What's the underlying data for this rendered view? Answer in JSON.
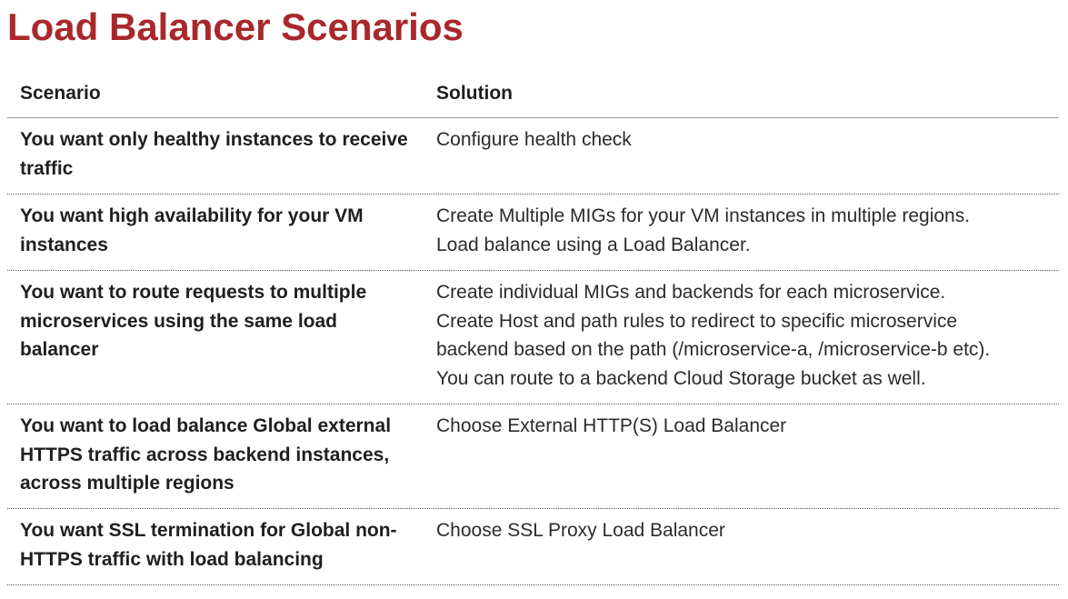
{
  "title": "Load Balancer Scenarios",
  "table": {
    "headers": {
      "scenario": "Scenario",
      "solution": "Solution"
    },
    "rows": [
      {
        "scenario": "You want only healthy instances to receive traffic",
        "solution": [
          "Configure health check"
        ]
      },
      {
        "scenario": "You want high availability for your VM instances",
        "solution": [
          "Create Multiple MIGs for your VM instances in multiple regions.",
          "Load balance using a Load Balancer."
        ]
      },
      {
        "scenario": "You want to route requests to multiple microservices using the same load balancer",
        "solution": [
          "Create individual MIGs and backends for each microservice.",
          "Create Host and path rules to redirect to specific microservice",
          "backend based on the path (/microservice-a, /microservice-b etc).",
          "You can route to a backend Cloud Storage bucket as well."
        ]
      },
      {
        "scenario": "You want to load balance Global external HTTPS traffic across backend instances, across multiple regions",
        "solution": [
          "Choose External HTTP(S) Load Balancer"
        ]
      },
      {
        "scenario": "You want SSL termination for Global non-HTTPS traffic with load balancing",
        "solution": [
          "Choose SSL Proxy Load Balancer"
        ]
      }
    ]
  },
  "colors": {
    "title": "#a8282b",
    "text": "#1f1f1f"
  }
}
